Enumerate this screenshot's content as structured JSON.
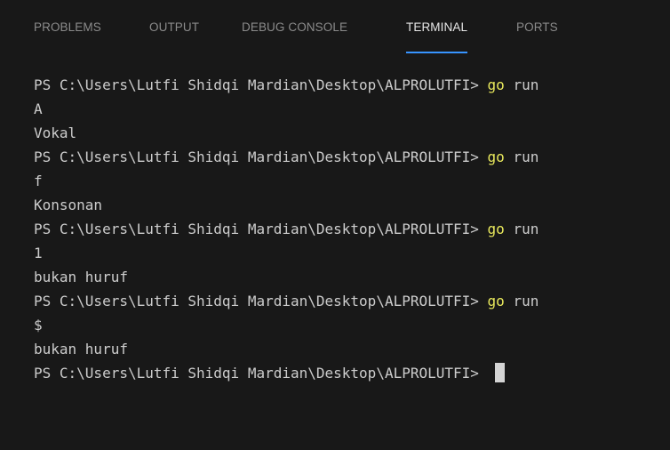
{
  "tabs": [
    {
      "label": "PROBLEMS",
      "active": false
    },
    {
      "label": "OUTPUT",
      "active": false
    },
    {
      "label": "DEBUG CONSOLE",
      "active": false
    },
    {
      "label": "TERMINAL",
      "active": true
    },
    {
      "label": "PORTS",
      "active": false
    }
  ],
  "terminal": {
    "prompt": "PS C:\\Users\\Lutfi Shidqi Mardian\\Desktop\\ALPROLUTFI> ",
    "command": "go",
    "command_arg": " run",
    "lines": [
      {
        "kind": "prompt_cmd"
      },
      {
        "kind": "output",
        "text": "A"
      },
      {
        "kind": "output",
        "text": "Vokal"
      },
      {
        "kind": "prompt_cmd"
      },
      {
        "kind": "output",
        "text": "f"
      },
      {
        "kind": "output",
        "text": "Konsonan"
      },
      {
        "kind": "prompt_cmd"
      },
      {
        "kind": "output",
        "text": "1"
      },
      {
        "kind": "output",
        "text": "bukan huruf"
      },
      {
        "kind": "prompt_cmd"
      },
      {
        "kind": "output",
        "text": "$"
      },
      {
        "kind": "output",
        "text": "bukan huruf"
      },
      {
        "kind": "prompt_cursor"
      }
    ]
  },
  "colors": {
    "background": "#181818",
    "text": "#cccccc",
    "command_highlight": "#e8e85c",
    "active_tab_underline": "#3794ff",
    "inactive_tab": "#8b8b8b",
    "active_tab": "#e7e7e7"
  }
}
